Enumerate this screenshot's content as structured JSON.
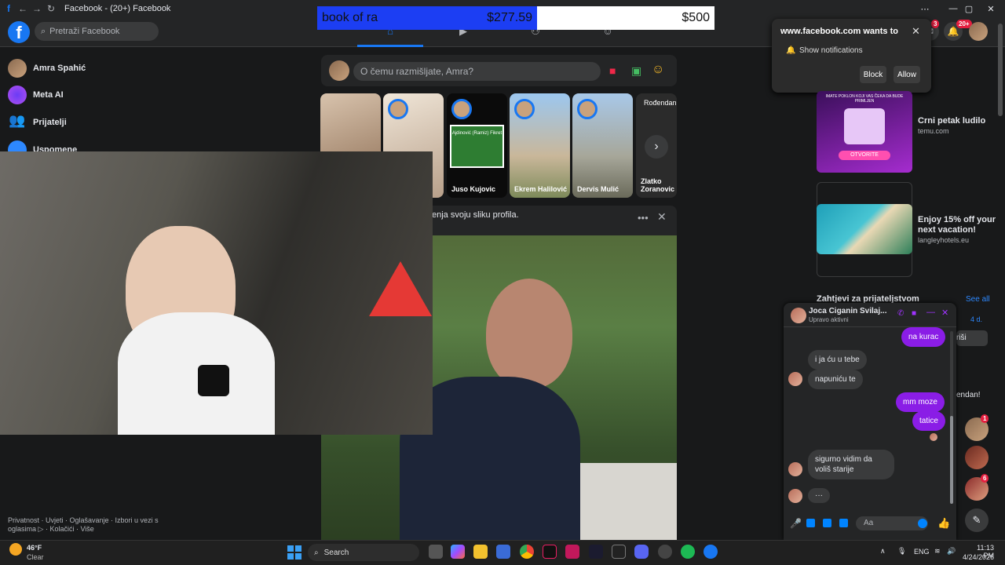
{
  "window": {
    "title": "Facebook - (20+) Facebook"
  },
  "overlay": {
    "left_label": "book of ra",
    "left_amount": "$277.59",
    "right_amount": "$500"
  },
  "header": {
    "search_placeholder": "Pretraži Facebook",
    "messenger_badge": "3",
    "notifications_badge": "20+"
  },
  "sidebar": {
    "items": [
      {
        "label": "Amra Spahić",
        "icon": "avatar"
      },
      {
        "label": "Meta AI",
        "icon": "meta-ai-icon"
      },
      {
        "label": "Prijatelji",
        "icon": "friends-icon"
      },
      {
        "label": "Uspomene",
        "icon": "memories-icon"
      }
    ],
    "footer": "Privatnost · Uvjeti · Oglašavanje · Izbori u vezi s oglasima ▷ · Kolačići · Više"
  },
  "composer": {
    "placeholder": "O čemu razmišljate, Amra?"
  },
  "stories": [
    {
      "name": ""
    },
    {
      "name": ""
    },
    {
      "name": "Juso Kujovic"
    },
    {
      "name": "Ekrem Halilović"
    },
    {
      "name": "Dervis Mulić"
    },
    {
      "name": "Zlatko Zoranovic",
      "tag": "Rođendan"
    }
  ],
  "memorial": {
    "title": "Ajdinović (Ramiz) Fikret"
  },
  "post": {
    "header_text": "enja svoju sliku profila."
  },
  "notification_prompt": {
    "title": "www.facebook.com wants to",
    "option": "Show notifications",
    "block_label": "Block",
    "allow_label": "Allow"
  },
  "ads": [
    {
      "title": "Crni petak ludilo",
      "domain": "temu.com",
      "banner_text": "IMATE POKLON KOJI VAS ČEKA DA BUDE PRIMLJEN",
      "button": "OTVORITE"
    },
    {
      "title": "Enjoy 15% off your next vacation!",
      "domain": "langleyhotels.eu"
    }
  ],
  "friend_requests": {
    "heading": "Zahtjevi za prijateljstvom",
    "see_all": "See all",
    "time": "4 d.",
    "delete_partial": "riši",
    "birthday_partial": "endan!"
  },
  "contacts_badges": [
    "1",
    "6"
  ],
  "chat": {
    "name": "Joca Ciganin Svilaj...",
    "status": "Upravo aktivni",
    "input_placeholder": "Aa",
    "messages": [
      {
        "dir": "out",
        "text": "na kurac"
      },
      {
        "dir": "in",
        "text": "i ja ću u tebe"
      },
      {
        "dir": "in",
        "text": "napuniću te"
      },
      {
        "dir": "out",
        "text": "mm moze"
      },
      {
        "dir": "out",
        "text": "tatice"
      },
      {
        "dir": "in",
        "text": "sigurno vidim da voliš starije"
      },
      {
        "dir": "in",
        "text": "···"
      }
    ]
  },
  "taskbar": {
    "weather_temp": "46°F",
    "weather_desc": "Clear",
    "search_label": "Search",
    "language": "ENG",
    "time": "11:13 PM",
    "date": "4/24/2026"
  },
  "colors": {
    "facebook_blue": "#1877f2",
    "messenger_purple": "#8a1de6",
    "badge_red": "#e41e3f",
    "overlay_blue": "#1c3ef3"
  }
}
